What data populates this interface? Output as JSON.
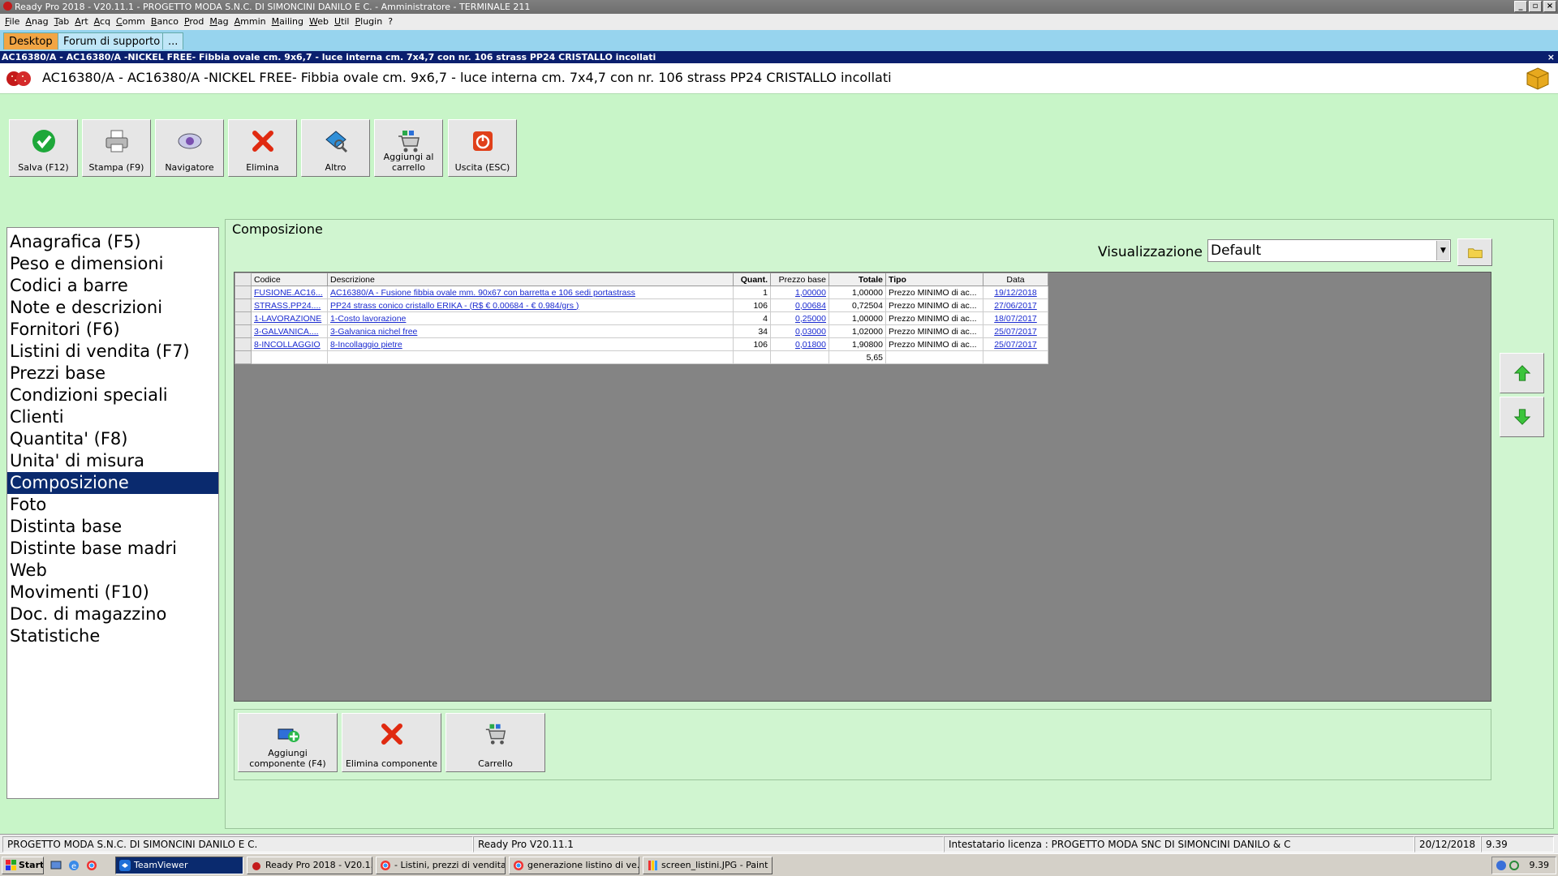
{
  "window": {
    "title": "Ready Pro 2018 - V20.11.1 - PROGETTO MODA S.N.C. DI SIMONCINI DANILO E C. - Amministratore - TERMINALE 211"
  },
  "menu": [
    "File",
    "Anag",
    "Tab",
    "Art",
    "Acq",
    "Comm",
    "Banco",
    "Prod",
    "Mag",
    "Ammin",
    "Mailing",
    "Web",
    "Util",
    "Plugin",
    "?"
  ],
  "tabs": [
    {
      "label": "Desktop",
      "active": true
    },
    {
      "label": "Forum di supporto",
      "active": false
    },
    {
      "label": "...",
      "active": false
    }
  ],
  "doc_bar": {
    "text": "AC16380/A - AC16380/A -NICKEL FREE- Fibbia ovale cm. 9x6,7 - luce interna cm. 7x4,7 con nr. 106 strass PP24 CRISTALLO incollati",
    "close": "×"
  },
  "header": {
    "title": "AC16380/A - AC16380/A -NICKEL FREE- Fibbia ovale cm. 9x6,7 - luce interna cm. 7x4,7 con nr. 106 strass PP24 CRISTALLO incollati"
  },
  "toolbar": [
    {
      "label": "Salva (F12)",
      "icon": "check-icon"
    },
    {
      "label": "Stampa (F9)",
      "icon": "printer-icon"
    },
    {
      "label": "Navigatore",
      "icon": "navigator-icon"
    },
    {
      "label": "Elimina",
      "icon": "delete-x-icon"
    },
    {
      "label": "Altro",
      "icon": "other-icon"
    },
    {
      "label": "Aggiungi al carrello",
      "icon": "cart-add-icon"
    },
    {
      "label": "Uscita (ESC)",
      "icon": "exit-icon"
    }
  ],
  "nav": [
    "Anagrafica (F5)",
    "Peso e dimensioni",
    "Codici a barre",
    "Note e descrizioni",
    "Fornitori (F6)",
    "Listini di vendita (F7)",
    "Prezzi base",
    "Condizioni speciali",
    "Clienti",
    "Quantita' (F8)",
    "Unita' di misura",
    "Composizione",
    "Foto",
    "Distinta base",
    "Distinte base madri",
    "Web",
    "Movimenti (F10)",
    "Doc. di magazzino",
    "Statistiche"
  ],
  "nav_selected_index": 11,
  "panel": {
    "title": "Composizione",
    "vis_label": "Visualizzazione :",
    "vis_value": "Default"
  },
  "grid": {
    "columns": [
      "Codice",
      "Descrizione",
      "Quant.",
      "Prezzo base",
      "Totale",
      "Tipo",
      "Data"
    ],
    "rows": [
      [
        "FUSIONE.AC16...",
        "AC16380/A - Fusione fibbia ovale mm. 90x67 con barretta e 106 sedi portastrass",
        "1",
        "1,00000",
        "1,00000",
        "Prezzo MINIMO di ac...",
        "19/12/2018"
      ],
      [
        "STRASS.PP24....",
        "PP24 strass conico cristallo ERIKA - (R$ € 0.00684 - € 0.984/grs )",
        "106",
        "0,00684",
        "0,72504",
        "Prezzo MINIMO di ac...",
        "27/06/2017"
      ],
      [
        "1-LAVORAZIONE",
        "1-Costo lavorazione",
        "4",
        "0,25000",
        "1,00000",
        "Prezzo MINIMO di ac...",
        "18/07/2017"
      ],
      [
        "3-GALVANICA....",
        "3-Galvanica nichel free",
        "34",
        "0,03000",
        "1,02000",
        "Prezzo MINIMO di ac...",
        "25/07/2017"
      ],
      [
        "8-INCOLLAGGIO",
        "8-Incollaggio pietre",
        "106",
        "0,01800",
        "1,90800",
        "Prezzo MINIMO di ac...",
        "25/07/2017"
      ]
    ],
    "total": "5,65"
  },
  "bottom_tools": [
    {
      "label": "Aggiungi componente (F4)",
      "icon": "add-component-icon"
    },
    {
      "label": "Elimina componente",
      "icon": "delete-component-icon"
    },
    {
      "label": "Carrello",
      "icon": "cart-icon"
    }
  ],
  "statusbar": {
    "company": "PROGETTO MODA S.N.C. DI SIMONCINI DANILO E C.",
    "version": "Ready Pro V20.11.1",
    "license": "Intestatario licenza : PROGETTO MODA SNC DI SIMONCINI DANILO & C",
    "date": "20/12/2018",
    "time": "9.39"
  },
  "taskbar": {
    "start": "Start",
    "items": [
      {
        "label": "TeamViewer",
        "active": true
      },
      {
        "label": "Ready Pro 2018 - V20.1...",
        "active": false
      },
      {
        "label": "- Listini, prezzi di vendita...",
        "active": false
      },
      {
        "label": "generazione listino di ve...",
        "active": false
      },
      {
        "label": "screen_listini.JPG - Paint",
        "active": false
      }
    ],
    "clock": "9.39"
  },
  "colors": {
    "accent": "#0a2a6e",
    "background": "#c8f5c8",
    "link": "#1a2ad0"
  }
}
